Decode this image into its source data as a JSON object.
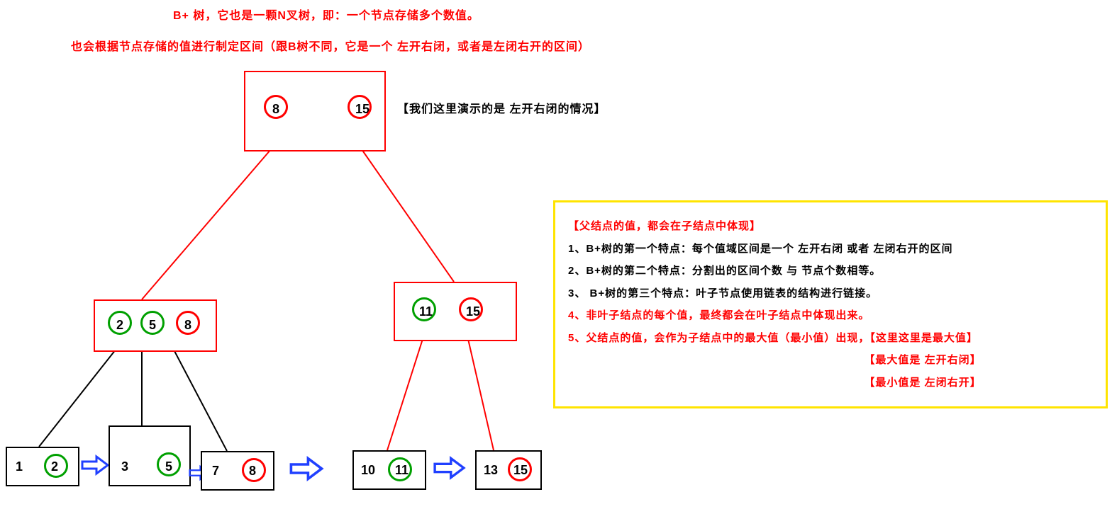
{
  "title_line1": "B+ 树，它也是一颗N叉树，即：一个节点存储多个数值。",
  "title_line2": "也会根据节点存储的值进行制定区间（跟B树不同，它是一个  左开右闭，或者是左闭右开的区间）",
  "root_note": "【我们这里演示的是  左开右闭的情况】",
  "root": {
    "v1": "8",
    "v2": "15"
  },
  "mid_left": {
    "v1": "2",
    "v2": "5",
    "v3": "8"
  },
  "mid_right": {
    "v1": "11",
    "v2": "15"
  },
  "leaf1": {
    "v1": "1",
    "v2": "2"
  },
  "leaf2": {
    "v1": "3",
    "v2": "5"
  },
  "leaf3": {
    "v1": "7",
    "v2": "8"
  },
  "leaf4": {
    "v1": "10",
    "v2": "11"
  },
  "leaf5": {
    "v1": "13",
    "v2": "15"
  },
  "info": {
    "l0": "【父结点的值，都会在子结点中体现】",
    "l1": "1、B+树的第一个特点：每个值域区间是一个  左开右闭  或者  左闭右开的区间",
    "l2": "2、B+树的第二个特点：分割出的区间个数  与  节点个数相等。",
    "l3": "3、 B+树的第三个特点：叶子节点使用链表的结构进行链接。",
    "l4": "4、非叶子结点的每个值，最终都会在叶子结点中体现出来。",
    "l5": "5、父结点的值，会作为子结点中的最大值（最小值）出现，【这里这里是最大值】",
    "l6": "【最大值是  左开右闭】",
    "l7": "【最小值是  左闭右开】"
  },
  "colors": {
    "red": "#ff0000",
    "green": "#00a000",
    "yellow": "#ffe400",
    "blue": "#2040ff"
  }
}
